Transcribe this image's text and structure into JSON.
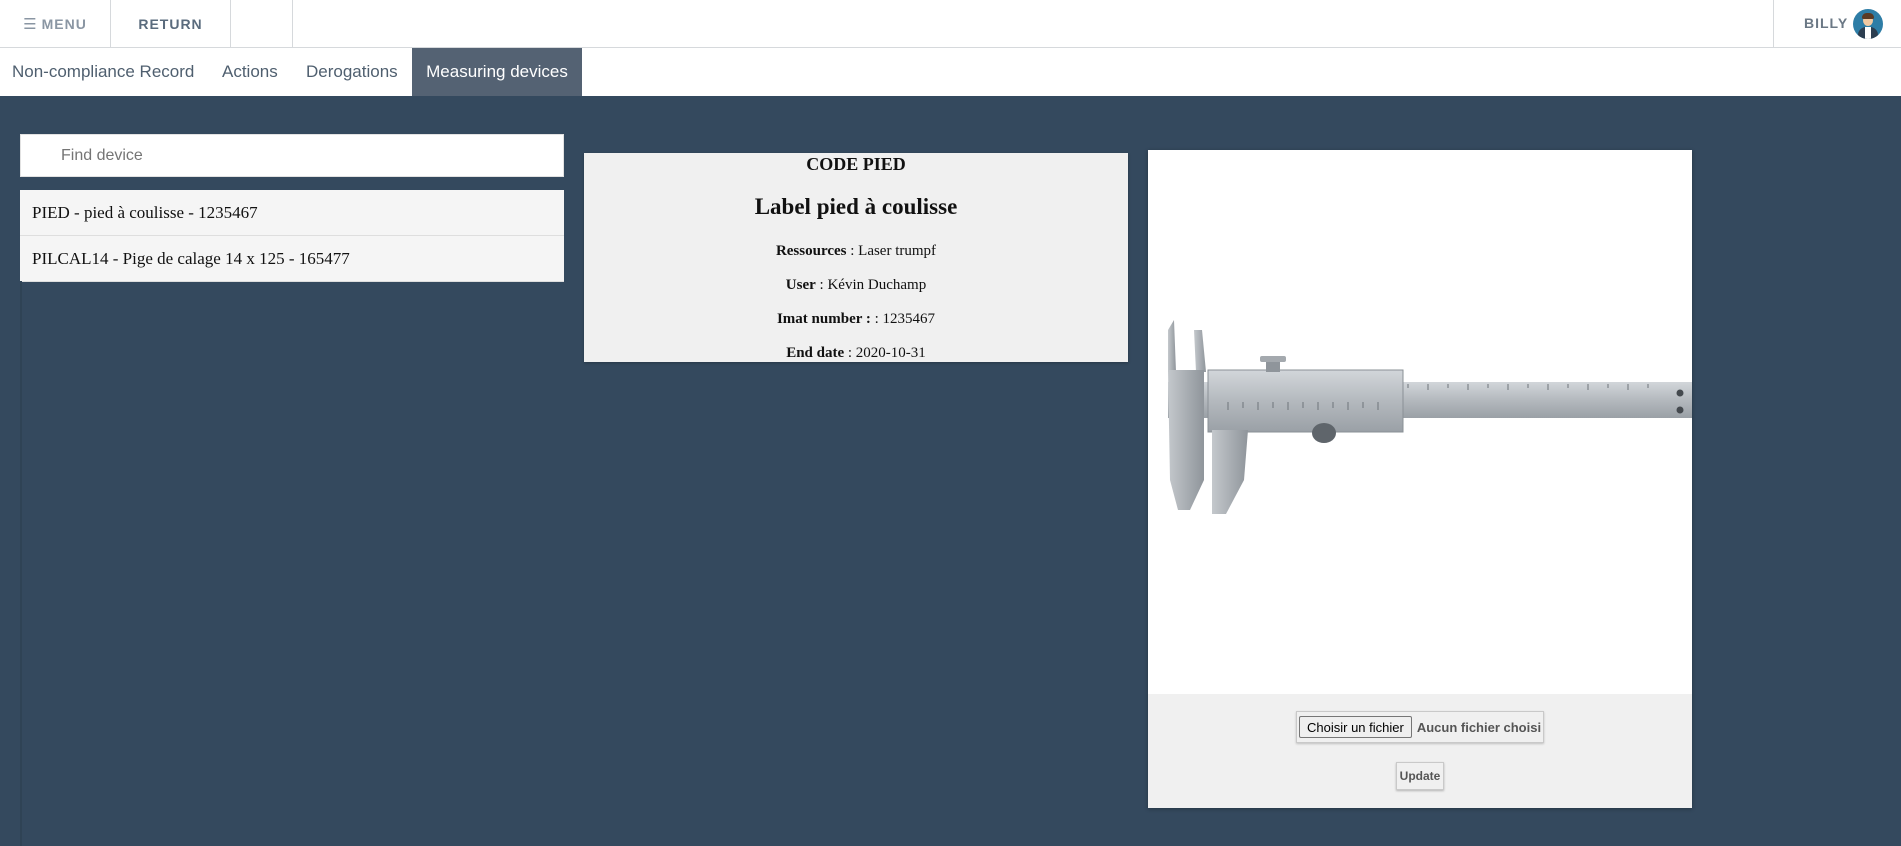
{
  "topbar": {
    "menu_icon": "☰",
    "menu_label": "MENU",
    "return_label": "RETURN",
    "user_name": "BILLY",
    "avatar_icon": "user-avatar"
  },
  "tabs": [
    {
      "label": "Non-compliance Record",
      "active": false
    },
    {
      "label": "Actions",
      "active": false
    },
    {
      "label": "Derogations",
      "active": false
    },
    {
      "label": "Measuring devices",
      "active": true
    }
  ],
  "search": {
    "placeholder": "Find device",
    "value": ""
  },
  "devices": [
    {
      "label": "PIED - pied à coulisse - 1235467"
    },
    {
      "label": "PILCAL14 - Pige de calage 14 x 125 - 165477"
    }
  ],
  "detail": {
    "code": "CODE PIED",
    "label": "Label pied à coulisse",
    "resources_label": "Ressources",
    "resources_value": " : Laser trumpf",
    "user_label": "User",
    "user_value": " : Kévin Duchamp",
    "imat_label": "Imat number : ",
    "imat_value": ": 1235467",
    "end_label": "End date",
    "end_value": " : 2020-10-31"
  },
  "image_panel": {
    "image_subject": "vernier caliper",
    "file_button": "Choisir un fichier",
    "file_status": "Aucun fichier choisi",
    "update_label": "Update"
  },
  "colors": {
    "background": "#34495e",
    "active_tab": "#546273",
    "card": "#f0f0f0"
  }
}
